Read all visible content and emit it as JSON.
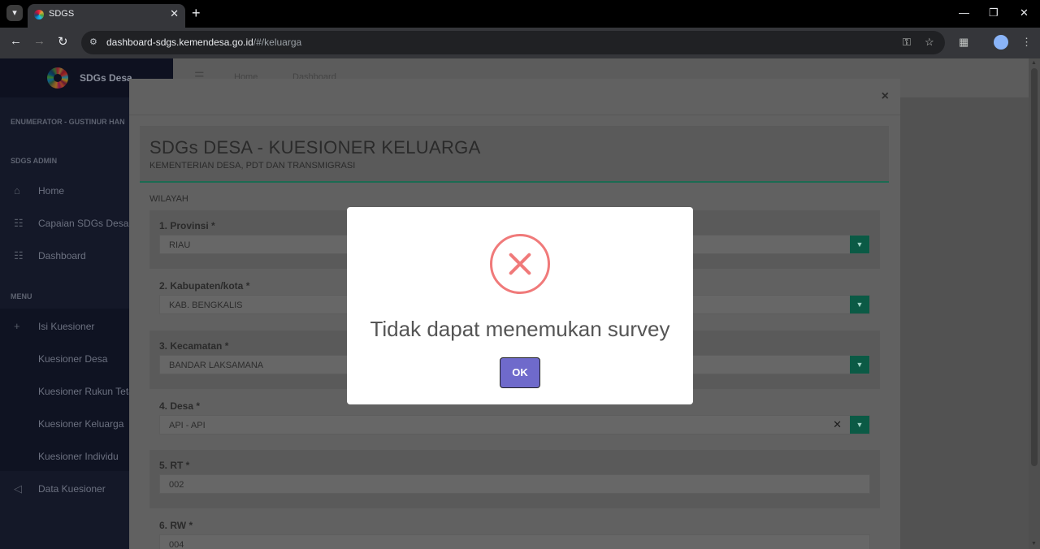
{
  "browser": {
    "tab_title": "SDGS",
    "url_host": "dashboard-sdgs.kemendesa.go.id",
    "url_path": "/#/keluarga"
  },
  "sidebar": {
    "brand": "SDGs Desa",
    "user_label": "ENUMERATOR - GUSTINUR HAN",
    "section_admin": "SDGS ADMIN",
    "admin_items": [
      {
        "label": "Home",
        "icon": "home-icon"
      },
      {
        "label": "Capaian SDGs Desa",
        "icon": "building-icon"
      },
      {
        "label": "Dashboard",
        "icon": "building-icon"
      }
    ],
    "section_menu": "MENU",
    "menu_items": [
      {
        "label": "Isi Kuesioner",
        "icon": "plus-icon"
      },
      {
        "label": "Kuesioner Desa"
      },
      {
        "label": "Kuesioner Rukun Teta"
      },
      {
        "label": "Kuesioner Keluarga"
      },
      {
        "label": "Kuesioner Individu"
      },
      {
        "label": "Data Kuesioner",
        "icon": "send-icon"
      }
    ]
  },
  "topnav": {
    "links": [
      "Home",
      "Dashboard"
    ]
  },
  "form": {
    "title": "SDGs DESA - KUESIONER KELUARGA",
    "subtitle": "KEMENTERIAN DESA, PDT DAN TRANSMIGRASI",
    "section": "WILAYAH",
    "fields": [
      {
        "label": "1. Provinsi *",
        "value": "RIAU"
      },
      {
        "label": "2. Kabupaten/kota *",
        "value": "KAB. BENGKALIS"
      },
      {
        "label": "3. Kecamatan *",
        "value": "BANDAR LAKSAMANA"
      },
      {
        "label": "4. Desa *",
        "value": "API - API"
      },
      {
        "label": "5. RT *",
        "value": "002"
      },
      {
        "label": "6. RW *",
        "value": "004"
      }
    ]
  },
  "alert": {
    "message": "Tidak dapat menemukan survey",
    "ok_label": "OK",
    "icon_color": "#f07a7a",
    "button_color": "#6f6acb"
  }
}
